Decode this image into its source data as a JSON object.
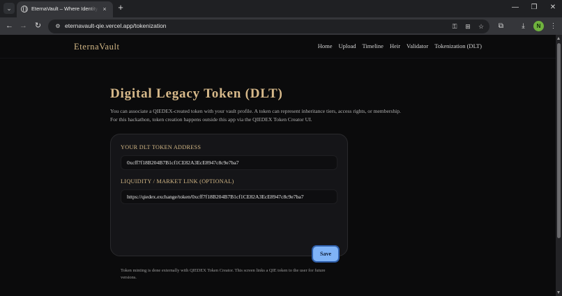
{
  "browser": {
    "tab_title": "EternaVault – Where Identity M",
    "url": "eternavault-qie.vercel.app/tokenization",
    "profile_initial": "N",
    "tab_menu_icon": "chevron-down-icon",
    "new_tab_symbol": "+",
    "close_tab_symbol": "×"
  },
  "site": {
    "logo": "EternaVault",
    "nav": [
      "Home",
      "Upload",
      "Timeline",
      "Heir",
      "Validator",
      "Tokenization (DLT)"
    ]
  },
  "page": {
    "title": "Digital Legacy Token (DLT)",
    "description_line1": "You can associate a QIEDEX-created token with your vault profile. A token can represent inheritance tiers, access rights, or membership.",
    "description_line2": "For this hackathon, token creation happens outside this app via the QIEDEX Token Creator UI."
  },
  "form": {
    "token_label": "YOUR DLT TOKEN ADDRESS",
    "token_value": "0xcff7f18B204B7B1cf1CE82A3EcE8947c8c9e7ba7",
    "link_label": "LIQUIDITY / MARKET LINK (OPTIONAL)",
    "link_value": "https://qiedex.exchange/token/0xcff7f18B204B7B1cf1CE82A3EcE8947c8c9e7ba7",
    "save_label": "Save",
    "note": "Token minting is done externally with QIEDEX Token Creator. This screen links a QIE token to the user for future versions."
  },
  "colors": {
    "accent_gold": "#d4b886",
    "button_blue": "#7fb3f7",
    "background": "#0b0b0c",
    "card": "#151518"
  }
}
